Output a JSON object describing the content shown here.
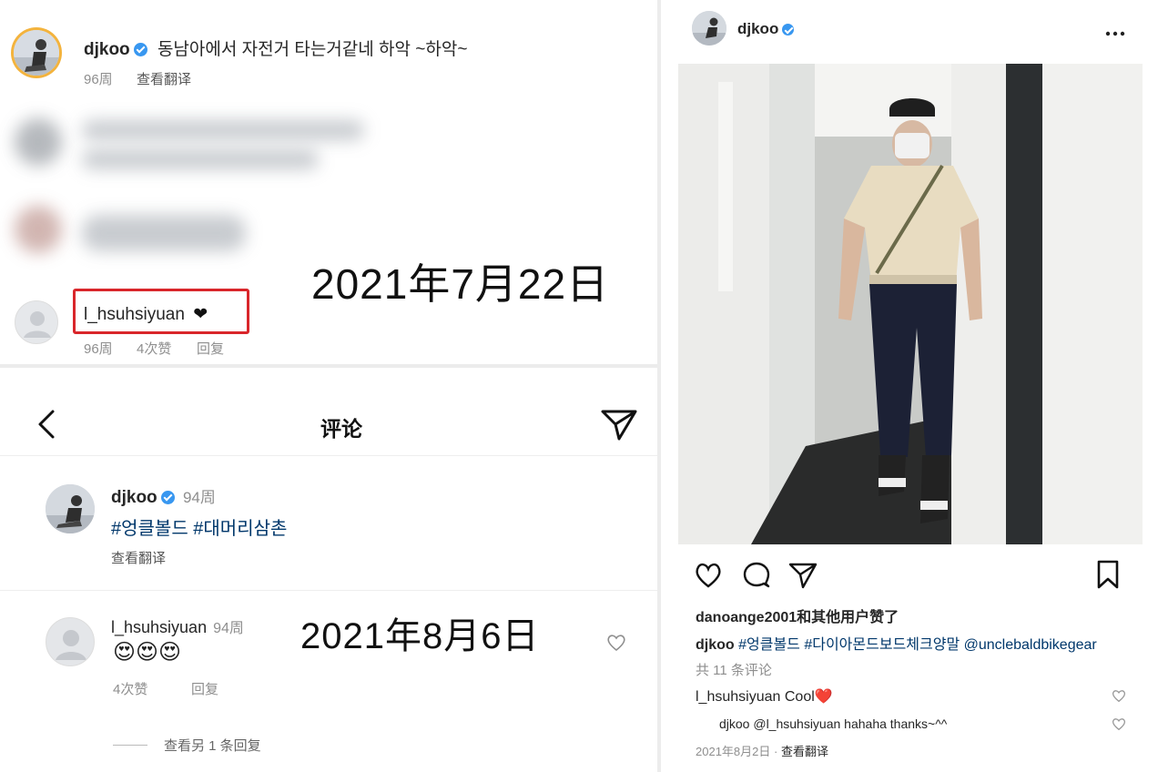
{
  "top_comment": {
    "username": "djkoo",
    "caption": "동남아에서 자전거 타는거같네 하악 ~하악~",
    "age": "96周",
    "translate": "查看翻译"
  },
  "reply_comment": {
    "username": "l_hsuhsiyuan",
    "heart": "❤",
    "age": "96周",
    "likes": "4次赞",
    "reply": "回复"
  },
  "date_label_1": "2021年7月22日",
  "comments_screen": {
    "back_icon": "chevron-left-icon",
    "title": "评论",
    "send_icon": "paper-plane-icon",
    "post": {
      "username": "djkoo",
      "age": "94周",
      "tags": "#엉클볼드 #대머리삼촌",
      "translate": "查看翻译"
    },
    "comment": {
      "username": "l_hsuhsiyuan",
      "age": "94周",
      "emojis": "😍😍😍",
      "likes": "4次赞",
      "reply": "回复",
      "more_replies": "查看另 1 条回复"
    }
  },
  "date_label_2": "2021年8月6日",
  "post_view": {
    "username": "djkoo",
    "more_icon": "more-horizontal-icon",
    "liked_by": "danoange2001和其他用户赞了",
    "caption_user": "djkoo",
    "caption_text": "#엉클볼드 #다이아몬드보드체크양말 @unclebaldbikegear",
    "view_comments": "共 11 条评论",
    "comment1_user": "l_hsuhsiyuan",
    "comment1_text": "Cool",
    "comment1_heart": "❤️",
    "comment2_user": "djkoo",
    "comment2_text": "@l_hsuhsiyuan hahaha thanks~^^",
    "date": "2021年8月2日",
    "translate": "查看翻译"
  },
  "colors": {
    "verified": "#3897f0",
    "highlight_box": "#d9262b",
    "hashtag": "#00376b",
    "heart_red": "#ed4956"
  }
}
